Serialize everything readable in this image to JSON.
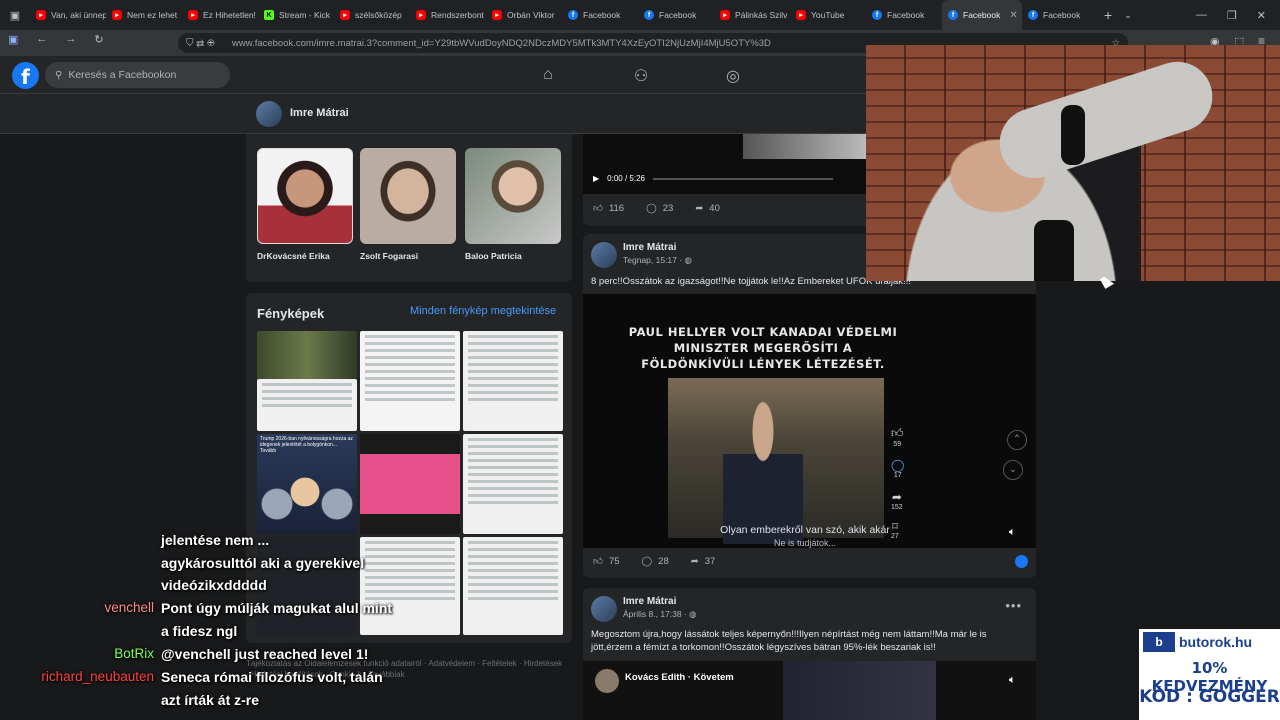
{
  "browser": {
    "tabs": [
      {
        "label": "Van, aki ünnep",
        "icon": "yt"
      },
      {
        "label": "Nem ez lehet",
        "icon": "yt"
      },
      {
        "label": "Ez Hihetetlen!",
        "icon": "yt"
      },
      {
        "label": "Stream - Kick",
        "icon": "kick"
      },
      {
        "label": "szélsőközép",
        "icon": "yt"
      },
      {
        "label": "Rendszerbont",
        "icon": "yt"
      },
      {
        "label": "Orbán Viktor",
        "icon": "yt"
      },
      {
        "label": "Facebook",
        "icon": "fb"
      },
      {
        "label": "Facebook",
        "icon": "fb"
      },
      {
        "label": "Pálinkás Szilv",
        "icon": "yt"
      },
      {
        "label": "YouTube",
        "icon": "yt"
      },
      {
        "label": "Facebook",
        "icon": "fb"
      },
      {
        "label": "Facebook",
        "icon": "fb",
        "active": true
      },
      {
        "label": "Facebook",
        "icon": "fb"
      }
    ],
    "url": "www.facebook.com/imre.matrai.3?comment_id=Y29tbWVudDoyNDQ2NDczMDY5MTk3MTY4XzEyOTI2NjUzMjI4MjU5OTY%3D"
  },
  "facebook": {
    "logo": "f",
    "search_placeholder": "Keresés a Facebookon",
    "profile_name": "Imre Mátrai",
    "friends": [
      {
        "name": "DrKovácsné Erika",
        "color": "#8a2b3a"
      },
      {
        "name": "Zsolt Fogarasi",
        "color": "#b9aca0"
      },
      {
        "name": "Baloo Patricia",
        "color": "#8e9aa0"
      }
    ],
    "photos": {
      "title": "Fényképek",
      "link": "Minden fénykép megtekintése",
      "trump_caption": "Trump 2026-ban nyilvánosságra hozza az idegenek jelenlétét a bolygónkon... Tovább"
    },
    "footer": "Tájékoztatás az Oldalelemzések funkció adatairól · Adatvédelem · Feltételek · Hirdetések · Hirdetési beállítások · Cookie-k · Továbbiak"
  },
  "top_video": {
    "time": "0:00 / 5:26",
    "progress": 0.0,
    "likes": "116",
    "comments": "23",
    "shares": "40"
  },
  "post1": {
    "author": "Imre Mátrai",
    "meta": "Tegnap, 15:17 · ",
    "text": "8 perc!!Osszátok az igazságot!!Ne tojjátok le!!Az Embereket UFOK uralják!!!",
    "video_title_1": "PAUL HELLYER VOLT KANADAI VÉDELMI",
    "video_title_2": "MINISZTER MEGERŐSÍTI A",
    "video_title_3": "FÖLDÖNKÍVÜLI LÉNYEK LÉTEZÉSÉT.",
    "subtitle_1": "Olyan emberekről van szó, akik akár",
    "subtitle_2": "Ne is tudjátok...",
    "side_likes": "59",
    "side_comments": "17",
    "side_shares": "152",
    "side_saves": "27",
    "likes": "75",
    "comments": "28",
    "shares": "37"
  },
  "post2": {
    "author": "Imre Mátrai",
    "meta": "Április 8., 17:38 · ",
    "text_1": "Megosztom újra,hogy lássátok teljes képernyőn!!!Ilyen népírtást még nem láttam!!Ma már le is",
    "text_2": "jött,érzem a fémízt a torkomon!!Osszátok légyszíves bátran 95%-lék beszariak is!!",
    "shared_author": "Kovács Edith · Követem"
  },
  "chat": [
    {
      "user": "",
      "text": "jelentése nem ..."
    },
    {
      "user": "",
      "text": "agykárosulttól aki a gyerekivel"
    },
    {
      "user": "",
      "text": "videózikxddddd"
    },
    {
      "user": "venchell",
      "user_color": "#ff8c8c",
      "text": "Pont úgy múlják magukat alul mint"
    },
    {
      "user": "",
      "text": "a fidesz ngl"
    },
    {
      "user": "BotRix",
      "user_color": "#7dff5a",
      "text": "@venchell just reached level 1!"
    },
    {
      "user": "richard_neubauten",
      "user_color": "#ff4040",
      "text": "Seneca római filozófus volt, talán"
    },
    {
      "user": "",
      "text": "azt írták át z-re"
    }
  ],
  "ad": {
    "logo": "b",
    "brand": "butorok.hu",
    "line1": "10% KEDVEZMÉNY",
    "line2": "KÓD : GOGGER"
  }
}
